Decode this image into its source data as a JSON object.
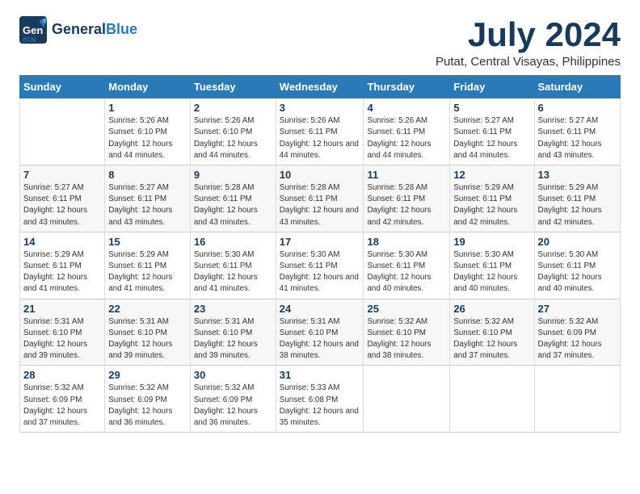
{
  "logo": {
    "general": "General",
    "blue": "Blue",
    "bird_unicode": "🐦"
  },
  "title": {
    "month_year": "July 2024",
    "location": "Putat, Central Visayas, Philippines"
  },
  "weekdays": [
    "Sunday",
    "Monday",
    "Tuesday",
    "Wednesday",
    "Thursday",
    "Friday",
    "Saturday"
  ],
  "weeks": [
    [
      {
        "day": "",
        "sunrise": "",
        "sunset": "",
        "daylight": ""
      },
      {
        "day": "1",
        "sunrise": "Sunrise: 5:26 AM",
        "sunset": "Sunset: 6:10 PM",
        "daylight": "Daylight: 12 hours and 44 minutes."
      },
      {
        "day": "2",
        "sunrise": "Sunrise: 5:26 AM",
        "sunset": "Sunset: 6:10 PM",
        "daylight": "Daylight: 12 hours and 44 minutes."
      },
      {
        "day": "3",
        "sunrise": "Sunrise: 5:26 AM",
        "sunset": "Sunset: 6:11 PM",
        "daylight": "Daylight: 12 hours and 44 minutes."
      },
      {
        "day": "4",
        "sunrise": "Sunrise: 5:26 AM",
        "sunset": "Sunset: 6:11 PM",
        "daylight": "Daylight: 12 hours and 44 minutes."
      },
      {
        "day": "5",
        "sunrise": "Sunrise: 5:27 AM",
        "sunset": "Sunset: 6:11 PM",
        "daylight": "Daylight: 12 hours and 44 minutes."
      },
      {
        "day": "6",
        "sunrise": "Sunrise: 5:27 AM",
        "sunset": "Sunset: 6:11 PM",
        "daylight": "Daylight: 12 hours and 43 minutes."
      }
    ],
    [
      {
        "day": "7",
        "sunrise": "Sunrise: 5:27 AM",
        "sunset": "Sunset: 6:11 PM",
        "daylight": "Daylight: 12 hours and 43 minutes."
      },
      {
        "day": "8",
        "sunrise": "Sunrise: 5:27 AM",
        "sunset": "Sunset: 6:11 PM",
        "daylight": "Daylight: 12 hours and 43 minutes."
      },
      {
        "day": "9",
        "sunrise": "Sunrise: 5:28 AM",
        "sunset": "Sunset: 6:11 PM",
        "daylight": "Daylight: 12 hours and 43 minutes."
      },
      {
        "day": "10",
        "sunrise": "Sunrise: 5:28 AM",
        "sunset": "Sunset: 6:11 PM",
        "daylight": "Daylight: 12 hours and 43 minutes."
      },
      {
        "day": "11",
        "sunrise": "Sunrise: 5:28 AM",
        "sunset": "Sunset: 6:11 PM",
        "daylight": "Daylight: 12 hours and 42 minutes."
      },
      {
        "day": "12",
        "sunrise": "Sunrise: 5:29 AM",
        "sunset": "Sunset: 6:11 PM",
        "daylight": "Daylight: 12 hours and 42 minutes."
      },
      {
        "day": "13",
        "sunrise": "Sunrise: 5:29 AM",
        "sunset": "Sunset: 6:11 PM",
        "daylight": "Daylight: 12 hours and 42 minutes."
      }
    ],
    [
      {
        "day": "14",
        "sunrise": "Sunrise: 5:29 AM",
        "sunset": "Sunset: 6:11 PM",
        "daylight": "Daylight: 12 hours and 41 minutes."
      },
      {
        "day": "15",
        "sunrise": "Sunrise: 5:29 AM",
        "sunset": "Sunset: 6:11 PM",
        "daylight": "Daylight: 12 hours and 41 minutes."
      },
      {
        "day": "16",
        "sunrise": "Sunrise: 5:30 AM",
        "sunset": "Sunset: 6:11 PM",
        "daylight": "Daylight: 12 hours and 41 minutes."
      },
      {
        "day": "17",
        "sunrise": "Sunrise: 5:30 AM",
        "sunset": "Sunset: 6:11 PM",
        "daylight": "Daylight: 12 hours and 41 minutes."
      },
      {
        "day": "18",
        "sunrise": "Sunrise: 5:30 AM",
        "sunset": "Sunset: 6:11 PM",
        "daylight": "Daylight: 12 hours and 40 minutes."
      },
      {
        "day": "19",
        "sunrise": "Sunrise: 5:30 AM",
        "sunset": "Sunset: 6:11 PM",
        "daylight": "Daylight: 12 hours and 40 minutes."
      },
      {
        "day": "20",
        "sunrise": "Sunrise: 5:30 AM",
        "sunset": "Sunset: 6:11 PM",
        "daylight": "Daylight: 12 hours and 40 minutes."
      }
    ],
    [
      {
        "day": "21",
        "sunrise": "Sunrise: 5:31 AM",
        "sunset": "Sunset: 6:10 PM",
        "daylight": "Daylight: 12 hours and 39 minutes."
      },
      {
        "day": "22",
        "sunrise": "Sunrise: 5:31 AM",
        "sunset": "Sunset: 6:10 PM",
        "daylight": "Daylight: 12 hours and 39 minutes."
      },
      {
        "day": "23",
        "sunrise": "Sunrise: 5:31 AM",
        "sunset": "Sunset: 6:10 PM",
        "daylight": "Daylight: 12 hours and 39 minutes."
      },
      {
        "day": "24",
        "sunrise": "Sunrise: 5:31 AM",
        "sunset": "Sunset: 6:10 PM",
        "daylight": "Daylight: 12 hours and 38 minutes."
      },
      {
        "day": "25",
        "sunrise": "Sunrise: 5:32 AM",
        "sunset": "Sunset: 6:10 PM",
        "daylight": "Daylight: 12 hours and 38 minutes."
      },
      {
        "day": "26",
        "sunrise": "Sunrise: 5:32 AM",
        "sunset": "Sunset: 6:10 PM",
        "daylight": "Daylight: 12 hours and 37 minutes."
      },
      {
        "day": "27",
        "sunrise": "Sunrise: 5:32 AM",
        "sunset": "Sunset: 6:09 PM",
        "daylight": "Daylight: 12 hours and 37 minutes."
      }
    ],
    [
      {
        "day": "28",
        "sunrise": "Sunrise: 5:32 AM",
        "sunset": "Sunset: 6:09 PM",
        "daylight": "Daylight: 12 hours and 37 minutes."
      },
      {
        "day": "29",
        "sunrise": "Sunrise: 5:32 AM",
        "sunset": "Sunset: 6:09 PM",
        "daylight": "Daylight: 12 hours and 36 minutes."
      },
      {
        "day": "30",
        "sunrise": "Sunrise: 5:32 AM",
        "sunset": "Sunset: 6:09 PM",
        "daylight": "Daylight: 12 hours and 36 minutes."
      },
      {
        "day": "31",
        "sunrise": "Sunrise: 5:33 AM",
        "sunset": "Sunset: 6:08 PM",
        "daylight": "Daylight: 12 hours and 35 minutes."
      },
      {
        "day": "",
        "sunrise": "",
        "sunset": "",
        "daylight": ""
      },
      {
        "day": "",
        "sunrise": "",
        "sunset": "",
        "daylight": ""
      },
      {
        "day": "",
        "sunrise": "",
        "sunset": "",
        "daylight": ""
      }
    ]
  ]
}
